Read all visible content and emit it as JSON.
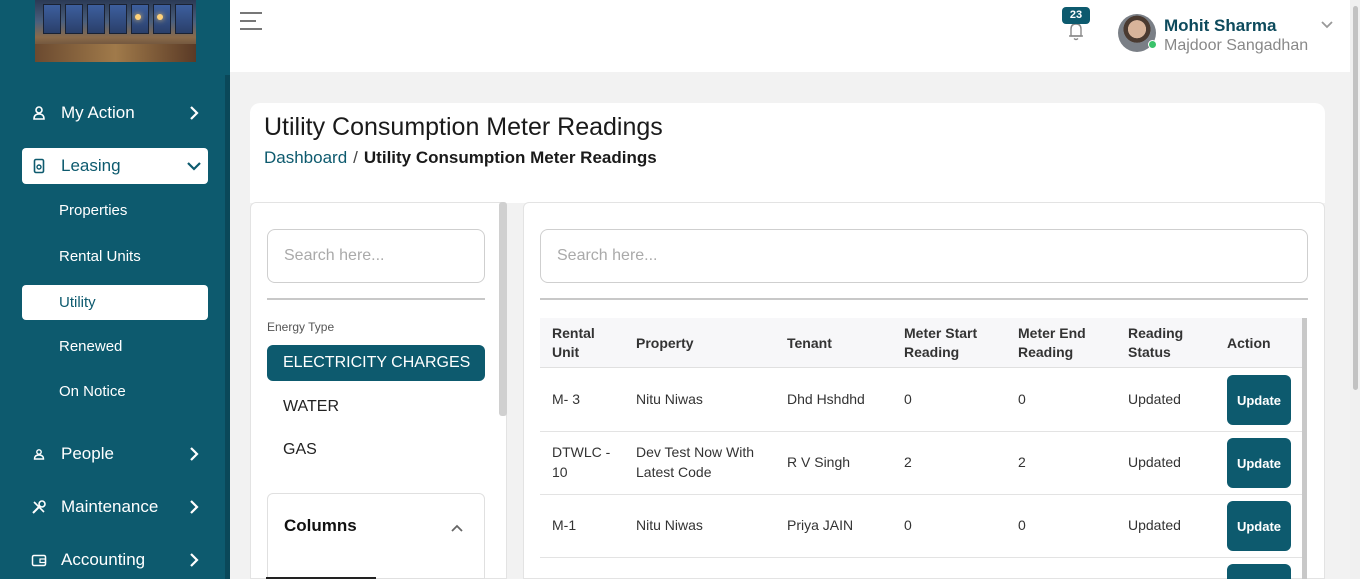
{
  "sidebar": {
    "nav": [
      {
        "label": "My Action",
        "icon": "user-icon"
      },
      {
        "label": "Leasing",
        "icon": "document-icon"
      },
      {
        "label": "People",
        "icon": "people-icon"
      },
      {
        "label": "Maintenance",
        "icon": "tools-icon"
      },
      {
        "label": "Accounting",
        "icon": "wallet-icon"
      }
    ],
    "sub_items": [
      "Properties",
      "Rental Units",
      "Utility",
      "Renewed",
      "On Notice"
    ]
  },
  "header": {
    "notification_count": "23",
    "user_name": "Mohit Sharma",
    "user_org": "Majdoor Sangadhan"
  },
  "page": {
    "title": "Utility Consumption Meter Readings",
    "breadcrumb": {
      "home": "Dashboard",
      "separator": "/",
      "current": "Utility Consumption Meter Readings"
    }
  },
  "filter": {
    "search_placeholder": "Search here...",
    "energy_label": "Energy Type",
    "energy_options": [
      "ELECTRICITY CHARGES",
      "WATER",
      "GAS"
    ],
    "selected_energy": "ELECTRICITY CHARGES",
    "columns_title": "Columns"
  },
  "table": {
    "search_placeholder": "Search here...",
    "headers": {
      "rental_unit": [
        "Rental",
        "Unit"
      ],
      "property": "Property",
      "tenant": "Tenant",
      "meter_start": [
        "Meter Start",
        "Reading"
      ],
      "meter_end": [
        "Meter End",
        "Reading"
      ],
      "status": [
        "Reading",
        "Status"
      ],
      "action": "Action"
    },
    "rows": [
      {
        "rental_unit": [
          "M- 3"
        ],
        "property": [
          "Nitu Niwas"
        ],
        "tenant": "Dhd Hshdhd",
        "meter_start": "0",
        "meter_end": "0",
        "status": "Updated",
        "action": "Update"
      },
      {
        "rental_unit": [
          "DTWLC -",
          "10"
        ],
        "property": [
          "Dev Test Now With",
          "Latest Code"
        ],
        "tenant": "R V Singh",
        "meter_start": "2",
        "meter_end": "2",
        "status": "Updated",
        "action": "Update"
      },
      {
        "rental_unit": [
          "M-1"
        ],
        "property": [
          "Nitu Niwas"
        ],
        "tenant": "Priya JAIN",
        "meter_start": "0",
        "meter_end": "0",
        "status": "Updated",
        "action": "Update"
      }
    ]
  },
  "colors": {
    "primary": "#0d5a6e",
    "online": "#3ac26a"
  }
}
